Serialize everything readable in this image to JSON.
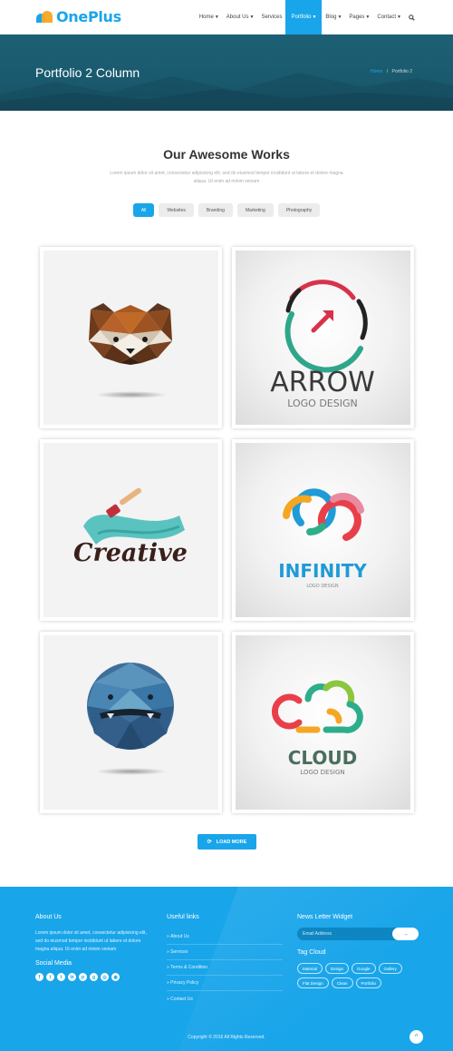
{
  "brand": {
    "name": "OnePlus"
  },
  "nav": {
    "items": [
      {
        "label": "Home",
        "caret": true,
        "active": false
      },
      {
        "label": "About Us",
        "caret": true,
        "active": false
      },
      {
        "label": "Services",
        "caret": false,
        "active": false
      },
      {
        "label": "Portfolio",
        "caret": true,
        "active": true
      },
      {
        "label": "Blog",
        "caret": true,
        "active": false
      },
      {
        "label": "Pages",
        "caret": true,
        "active": false
      },
      {
        "label": "Contact",
        "caret": true,
        "active": false
      }
    ],
    "search_icon": "search-icon"
  },
  "banner": {
    "title": "Portfolio 2 Column",
    "breadcrumb_home": "Home",
    "breadcrumb_sep": "/",
    "breadcrumb_current": "Portfolio 2"
  },
  "section": {
    "title": "Our Awesome Works",
    "description": "Lorem ipsum dolor sit amet, consectetur adipisicing elit, sed do eiusmod tempor incididunt ut labore et dolore magna aliqua. Ut enim ad minim veniam"
  },
  "filters": [
    {
      "label": "All",
      "active": true
    },
    {
      "label": "Websites",
      "active": false
    },
    {
      "label": "Branding",
      "active": false
    },
    {
      "label": "Marketing",
      "active": false
    },
    {
      "label": "Photography",
      "active": false
    }
  ],
  "portfolio": {
    "items": [
      {
        "name": "red-panda-lowpoly"
      },
      {
        "name": "arrow-logo",
        "word": "ARROW",
        "sub": "LOGO DESIGN"
      },
      {
        "name": "creative-logo",
        "word": "Creative"
      },
      {
        "name": "infinity-logo",
        "word": "INFINITY",
        "sub": "LOGO DESIGN"
      },
      {
        "name": "lowpoly-creature"
      },
      {
        "name": "cloud-logo",
        "word": "CLOUD",
        "sub": "LOGO DESIGN"
      }
    ]
  },
  "load_more": {
    "label": "LOAD MORE"
  },
  "footer": {
    "about": {
      "heading": "About Us",
      "text": "Lorem ipsum dolor sit amet, consectetur adipisicing elit, sed do eiusmod tempor incididunt ut labore et dolore magna aliqua. Ut enim ad minim veniam",
      "social_heading": "Social Media",
      "socials": [
        "f",
        "t",
        "t",
        "in",
        "p",
        "g",
        "◎",
        "◉"
      ]
    },
    "links": {
      "heading": "Useful links",
      "items": [
        "About Us",
        "Services",
        "Terms & Condition",
        "Privacy Policy",
        "Contact Us"
      ]
    },
    "newsletter": {
      "heading": "News Letter Widget",
      "placeholder": "Email Address",
      "button": "→"
    },
    "tags": {
      "heading": "Tag Cloud",
      "items": [
        "Material",
        "Design",
        "Google",
        "Gallery",
        "Flat Design",
        "Clean",
        "Portfolio"
      ]
    },
    "copyright": "Copyright © 2016 All Rights Reserved.",
    "scroll_top": "^"
  },
  "colors": {
    "accent": "#19a5ea",
    "banner": "#1d5f74"
  }
}
